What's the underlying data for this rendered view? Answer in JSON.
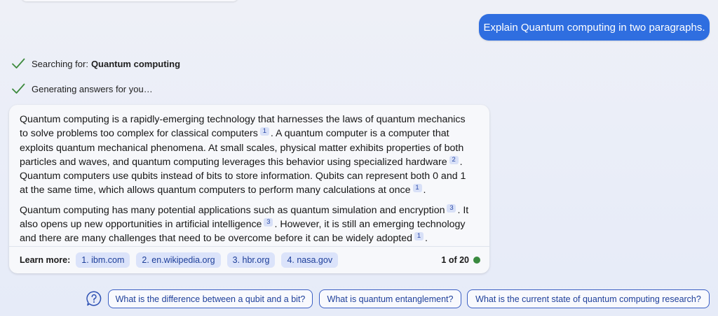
{
  "user_message": "Explain Quantum computing in two paragraphs.",
  "status": {
    "searching_label": "Searching for:",
    "searching_query": "Quantum computing",
    "generating_label": "Generating answers for you…"
  },
  "answer": {
    "p1": {
      "s1": "Quantum computing is a rapidly-emerging technology that harnesses the laws of quantum mechanics to solve problems too complex for classical computers",
      "c1": "1",
      "s2": ". A quantum computer is a computer that exploits quantum mechanical phenomena. At small scales, physical matter exhibits properties of both particles and waves, and quantum computing leverages this behavior using specialized hardware",
      "c2": "2",
      "s3": ". Quantum computers use qubits instead of bits to store information. Qubits can represent both 0 and 1 at the same time, which allows quantum computers to perform many calculations at once",
      "c3": "1",
      "s4": "."
    },
    "p2": {
      "s1": "Quantum computing has many potential applications such as quantum simulation and encryption",
      "c1": "3",
      "s2": ". It also opens up new opportunities in artificial intelligence",
      "c2": "3",
      "s3": ". However, it is still an emerging technology and there are many challenges that need to be overcome before it can be widely adopted",
      "c3": "1",
      "s4": "."
    }
  },
  "learn_more": {
    "label": "Learn more:",
    "sources": [
      "1. ibm.com",
      "2. en.wikipedia.org",
      "3. hbr.org",
      "4. nasa.gov"
    ],
    "page_count": "1 of 20",
    "status_color": "#3a8a3f"
  },
  "suggestions": [
    "What is the difference between a qubit and a bit?",
    "What is quantum entanglement?",
    "What is the current state of quantum computing research?"
  ],
  "colors": {
    "accent": "#2f6ee0",
    "check": "#3d8a3d",
    "chip_border": "#3b5fc4"
  },
  "icons": {
    "status": "checkmark-icon",
    "suggestions": "question-help-icon"
  }
}
